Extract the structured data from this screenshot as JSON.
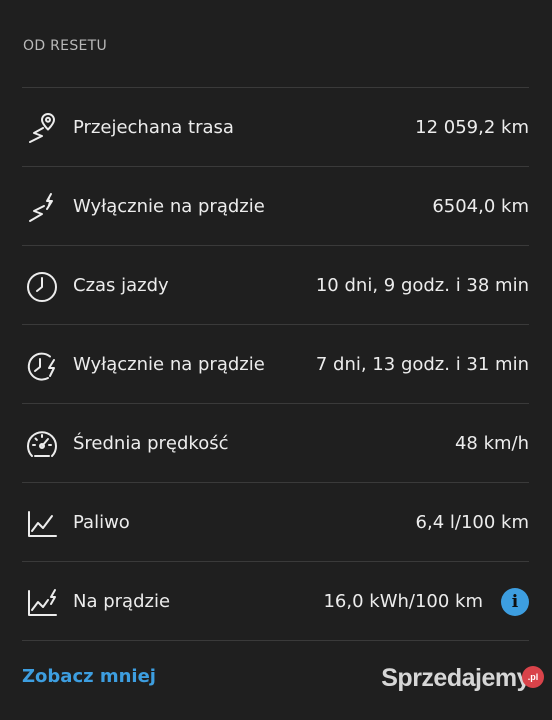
{
  "section": {
    "title": "OD RESETU"
  },
  "rows": [
    {
      "icon": "route-pin-icon",
      "label": "Przejechana trasa",
      "value": "12 059,2 km"
    },
    {
      "icon": "electric-route-icon",
      "label": "Wyłącznie na prądzie",
      "value": "6504,0 km"
    },
    {
      "icon": "clock-icon",
      "label": "Czas jazdy",
      "value": "10 dni, 9 godz. i 38 min"
    },
    {
      "icon": "electric-clock-icon",
      "label": "Wyłącznie na prądzie",
      "value": "7 dni, 13 godz. i 31 min"
    },
    {
      "icon": "speedometer-icon",
      "label": "Średnia prędkość",
      "value": "48 km/h"
    },
    {
      "icon": "consumption-chart-icon",
      "label": "Paliwo",
      "value": "6,4 l/100 km"
    },
    {
      "icon": "electric-consumption-chart-icon",
      "label": "Na prądzie",
      "value": "16,0 kWh/100 km",
      "info": "i"
    }
  ],
  "footer": {
    "see_less": "Zobacz mniej"
  },
  "watermark": {
    "text": "Sprzedajemy",
    "suffix": ".pl"
  },
  "colors": {
    "background": "#1f1f1f",
    "divider": "#3a3a3a",
    "accent": "#3d9ee0",
    "text": "#ececec"
  }
}
